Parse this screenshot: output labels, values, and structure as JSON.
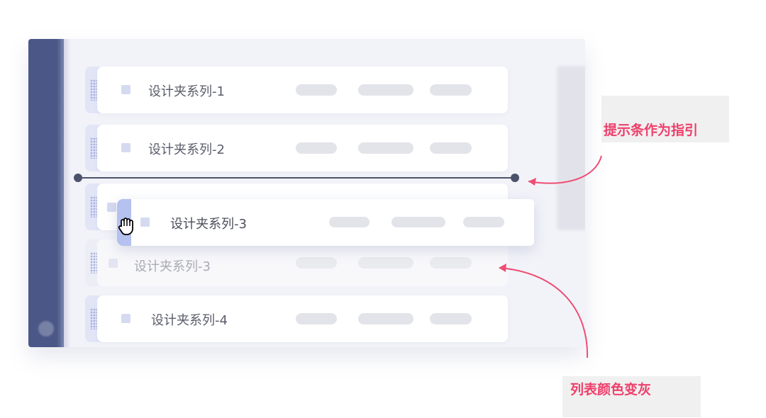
{
  "list": {
    "items": [
      {
        "label": "设计夹系列-1"
      },
      {
        "label": "设计夹系列-2"
      },
      {
        "label": "设计夹系列-3"
      },
      {
        "label": "设计夹系列-4"
      }
    ],
    "placeholder_row_label": "设计夹系列-3"
  },
  "dragging_item": {
    "label": "设计夹系列-3"
  },
  "annotations": {
    "guide_bar": "提示条作为指引",
    "gray_list": "列表颜色变灰"
  },
  "colors": {
    "sidebar": "#4a5787",
    "guide_line": "#4b536b",
    "annotation": "#ee3f6b",
    "drag_strip": "#b5c1ee"
  },
  "icons": {
    "drag_handle": "drag-handle-icon",
    "cursor": "grab-hand-cursor-icon"
  }
}
